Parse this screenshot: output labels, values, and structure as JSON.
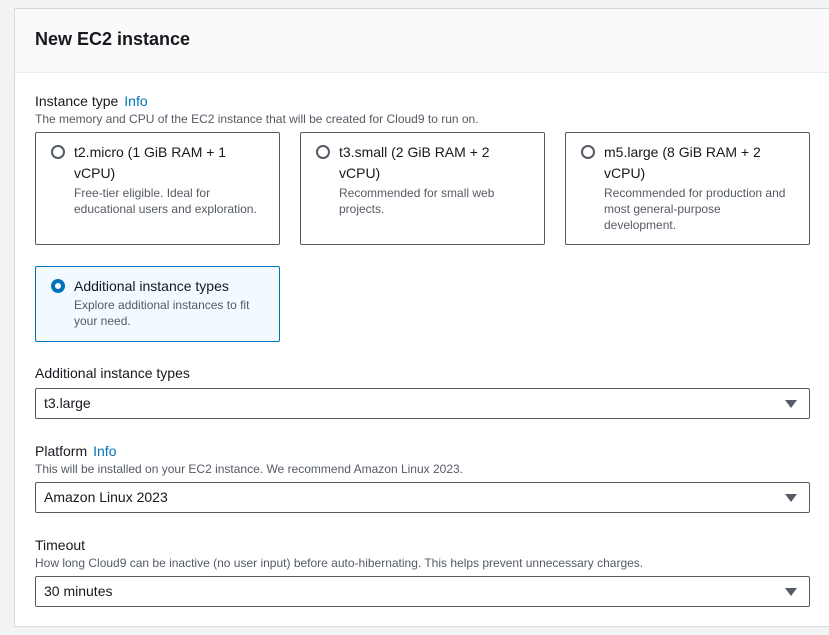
{
  "panel": {
    "title": "New EC2 instance"
  },
  "instance_type": {
    "label": "Instance type",
    "info": "Info",
    "description": "The memory and CPU of the EC2 instance that will be created for Cloud9 to run on.",
    "options": [
      {
        "title": "t2.micro (1 GiB RAM + 1 vCPU)",
        "description": "Free-tier eligible. Ideal for educational users and exploration.",
        "selected": false
      },
      {
        "title": "t3.small (2 GiB RAM + 2 vCPU)",
        "description": "Recommended for small web projects.",
        "selected": false
      },
      {
        "title": "m5.large (8 GiB RAM + 2 vCPU)",
        "description": "Recommended for production and most general-purpose development.",
        "selected": false
      },
      {
        "title": "Additional instance types",
        "description": "Explore additional instances to fit your need.",
        "selected": true
      }
    ]
  },
  "additional_instance_types": {
    "label": "Additional instance types",
    "value": "t3.large"
  },
  "platform": {
    "label": "Platform",
    "info": "Info",
    "description": "This will be installed on your EC2 instance. We recommend Amazon Linux 2023.",
    "value": "Amazon Linux 2023"
  },
  "timeout": {
    "label": "Timeout",
    "description": "How long Cloud9 can be inactive (no user input) before auto-hibernating. This helps prevent unnecessary charges.",
    "value": "30 minutes"
  },
  "colors": {
    "accent": "#0073bb",
    "text": "#16191f",
    "muted": "#545b64"
  }
}
